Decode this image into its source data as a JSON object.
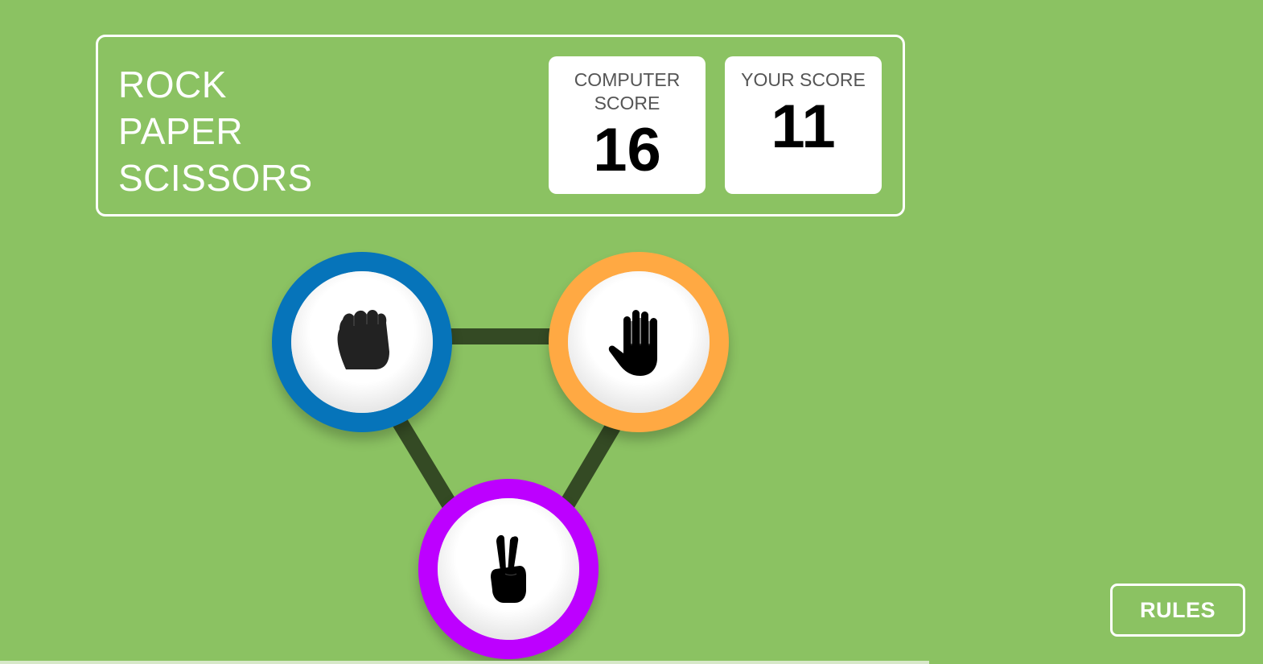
{
  "title_lines": [
    "ROCK",
    "PAPER",
    "SCISSORS"
  ],
  "scores": {
    "computer_label": "COMPUTER SCORE",
    "computer_value": "16",
    "user_label": "YOUR SCORE",
    "user_value": "11"
  },
  "choices": [
    {
      "name": "rock",
      "icon": "fist-icon",
      "color": "#0674ba"
    },
    {
      "name": "paper",
      "icon": "open-hand-icon",
      "color": "#ffa943"
    },
    {
      "name": "scissors",
      "icon": "peace-hand-icon",
      "color": "#bd00ff"
    }
  ],
  "rules_label": "RULES",
  "colors": {
    "background": "#8bc262",
    "connector": "#344a24",
    "rock": "#0674ba",
    "paper": "#ffa943",
    "scissors": "#bd00ff"
  }
}
